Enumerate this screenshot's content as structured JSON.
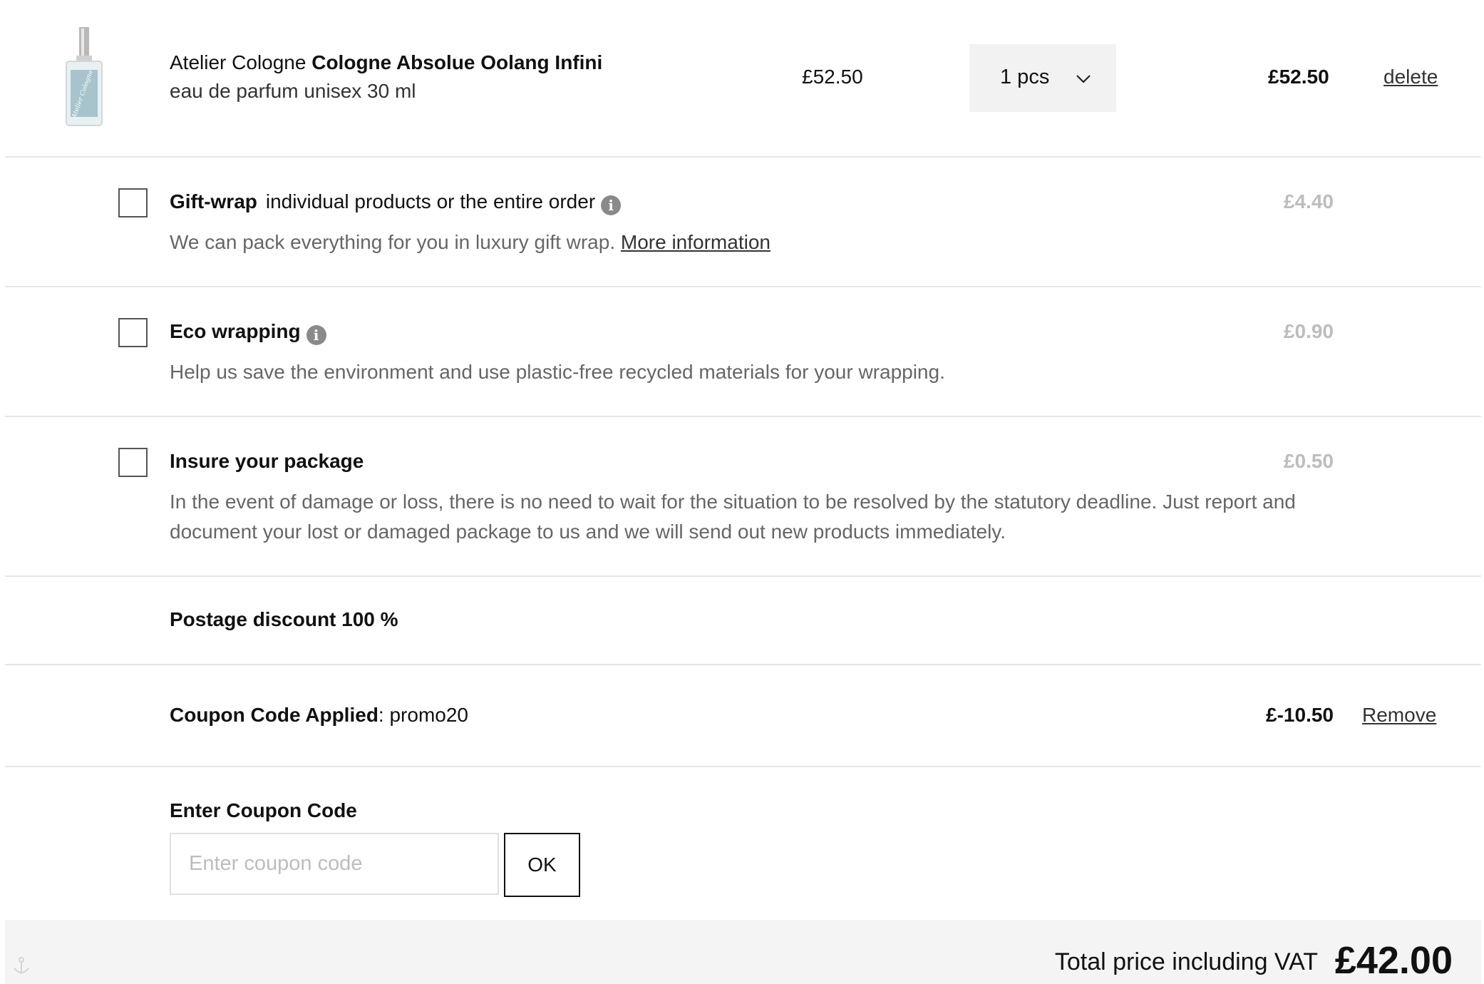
{
  "product": {
    "brand": "Atelier Cologne",
    "name": "Cologne Absolue Oolang Infini",
    "subtitle": "eau de parfum unisex 30 ml",
    "unit_price": "£52.50",
    "quantity": "1 pcs",
    "line_total": "£52.50",
    "delete_label": "delete",
    "image_icon": "perfume-bottle-image"
  },
  "options": {
    "giftwrap": {
      "title": "Gift-wrap",
      "title_rest": "individual products or the entire order",
      "description": "We can pack everything for you in luxury gift wrap.",
      "more_link": "More information",
      "price": "£4.40",
      "checked": false
    },
    "eco": {
      "title": "Eco wrapping",
      "description": "Help us save the environment and use plastic-free recycled materials for your wrapping.",
      "price": "£0.90",
      "checked": false
    },
    "insure": {
      "title": "Insure your package",
      "description": "In the event of damage or loss, there is no need to wait for the situation to be resolved by the statutory deadline. Just report and document your lost or damaged package to us and we will send out new products immediately.",
      "price": "£0.50",
      "checked": false
    }
  },
  "postage": {
    "label": "Postage discount 100 %"
  },
  "coupon_applied": {
    "label": "Coupon Code Applied",
    "code": "promo20",
    "amount": "£-10.50",
    "remove_label": "Remove"
  },
  "coupon_entry": {
    "label": "Enter Coupon Code",
    "placeholder": "Enter coupon code",
    "value": "",
    "ok_label": "OK"
  },
  "total": {
    "label": "Total price including VAT",
    "value": "£42.00"
  },
  "colors": {
    "muted_price": "#bdbdbd",
    "description_text": "#666666",
    "divider": "#e6e6e6",
    "total_bar": "#f4f4f4"
  }
}
